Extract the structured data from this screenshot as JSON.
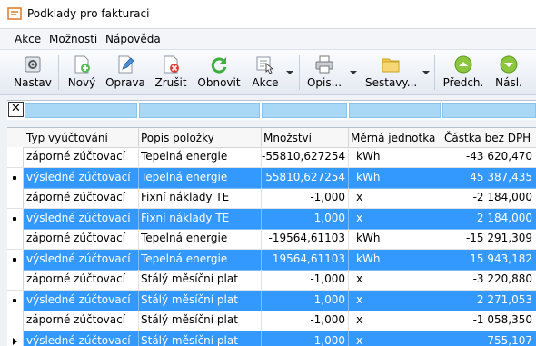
{
  "window": {
    "title": "Podklady pro fakturaci"
  },
  "menu": [
    "Akce",
    "Možnosti",
    "Nápověda"
  ],
  "toolbar": {
    "nastav": "Nastav",
    "novy": "Nový",
    "oprava": "Oprava",
    "zrusit": "Zrušit",
    "obnovit": "Obnovit",
    "akce": "Akce",
    "opis": "Opis...",
    "sestavy": "Sestavy...",
    "predch": "Předch.",
    "nasl": "Násl."
  },
  "grid": {
    "columns": [
      "Typ vyúčtování",
      "Popis položky",
      "Množství",
      "Měrná jednotka",
      "Částka bez DPH"
    ],
    "rows": [
      {
        "typ": "záporné zúčtovací",
        "popis": "Tepelná energie",
        "mnozstvi": "-55810,627254",
        "jednotka": "kWh",
        "castka": "-43 620,470",
        "selected": false,
        "marker": ""
      },
      {
        "typ": "výsledné zúčtovací",
        "popis": "Tepelná energie",
        "mnozstvi": "55810,627254",
        "jednotka": "kWh",
        "castka": "45 387,435",
        "selected": true,
        "marker": "dot"
      },
      {
        "typ": "záporné zúčtovací",
        "popis": "Fixní náklady TE",
        "mnozstvi": "-1,000",
        "jednotka": "x",
        "castka": "-2 184,000",
        "selected": false,
        "marker": ""
      },
      {
        "typ": "výsledné zúčtovací",
        "popis": "Fixní náklady TE",
        "mnozstvi": "1,000",
        "jednotka": "x",
        "castka": "2 184,000",
        "selected": true,
        "marker": "dot"
      },
      {
        "typ": "záporné zúčtovací",
        "popis": "Tepelná energie",
        "mnozstvi": "-19564,61103",
        "jednotka": "kWh",
        "castka": "-15 291,309",
        "selected": false,
        "marker": ""
      },
      {
        "typ": "výsledné zúčtovací",
        "popis": "Tepelná energie",
        "mnozstvi": "19564,61103",
        "jednotka": "kWh",
        "castka": "15 943,182",
        "selected": true,
        "marker": "dot"
      },
      {
        "typ": "záporné zúčtovací",
        "popis": "Stálý měsíční plat",
        "mnozstvi": "-1,000",
        "jednotka": "x",
        "castka": "-3 220,880",
        "selected": false,
        "marker": ""
      },
      {
        "typ": "výsledné zúčtovací",
        "popis": "Stálý měsíční plat",
        "mnozstvi": "1,000",
        "jednotka": "x",
        "castka": "2 271,053",
        "selected": true,
        "marker": "dot"
      },
      {
        "typ": "záporné zúčtovací",
        "popis": "Stálý měsíční plat",
        "mnozstvi": "-1,000",
        "jednotka": "x",
        "castka": "-1 058,350",
        "selected": false,
        "marker": ""
      },
      {
        "typ": "výsledné zúčtovací",
        "popis": "Stálý měsíční plat",
        "mnozstvi": "1,000",
        "jednotka": "x",
        "castka": "755,107",
        "selected": true,
        "marker": "arrow"
      }
    ]
  }
}
